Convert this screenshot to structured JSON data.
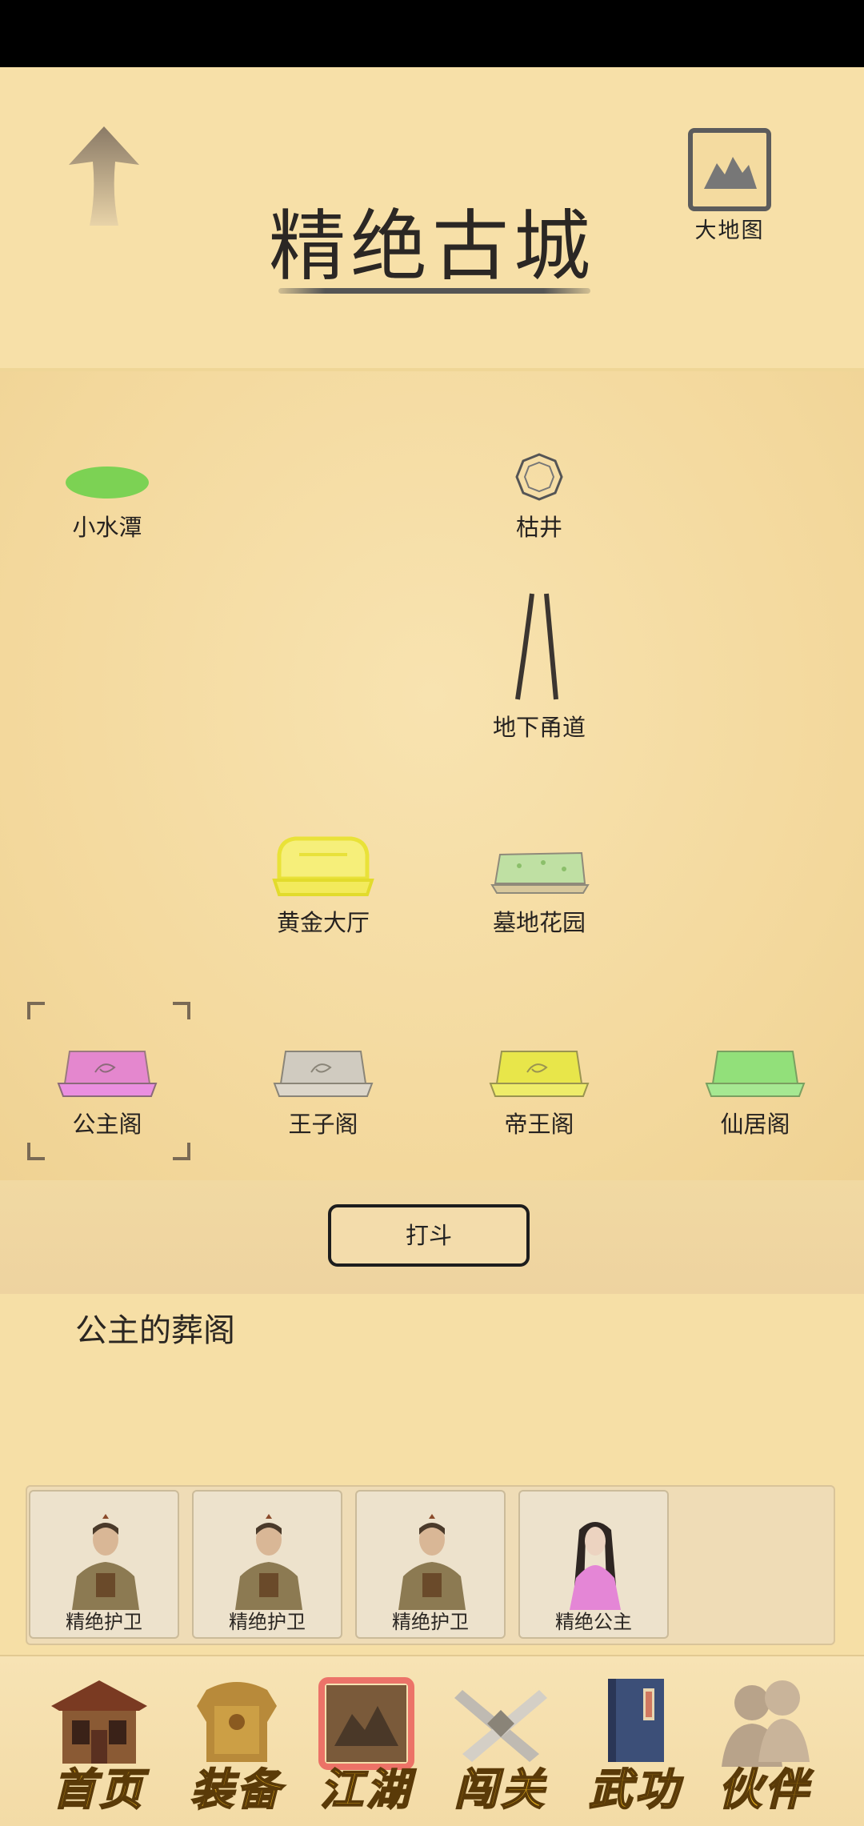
{
  "header": {
    "title": "精绝古城",
    "map_label": "大地图"
  },
  "locations": [
    {
      "label": "小水潭",
      "icon": "pond-icon"
    },
    {
      "label": "枯井",
      "icon": "well-icon"
    },
    {
      "label": "地下甬道",
      "icon": "tunnel-icon"
    },
    {
      "label": "黄金大厅",
      "icon": "golden-hall-icon"
    },
    {
      "label": "墓地花园",
      "icon": "cemetery-garden-icon"
    },
    {
      "label": "公主阁",
      "icon": "pavilion-icon",
      "color": "#e27ad8",
      "selected": true
    },
    {
      "label": "王子阁",
      "icon": "pavilion-icon",
      "color": "#c8c3b8"
    },
    {
      "label": "帝王阁",
      "icon": "pavilion-icon",
      "color": "#e8e64a"
    },
    {
      "label": "仙居阁",
      "icon": "pavilion-icon",
      "color": "#92e07a"
    }
  ],
  "fight_button": "打斗",
  "location_description": "公主的葬阁",
  "party": [
    {
      "name": "精绝护卫",
      "portrait": "guard-portrait-icon"
    },
    {
      "name": "精绝护卫",
      "portrait": "guard-portrait-icon"
    },
    {
      "name": "精绝护卫",
      "portrait": "guard-portrait-icon"
    },
    {
      "name": "精绝公主",
      "portrait": "princess-portrait-icon"
    }
  ],
  "nav": [
    {
      "label": "首页",
      "icon": "house-icon"
    },
    {
      "label": "装备",
      "icon": "armor-icon"
    },
    {
      "label": "江湖",
      "icon": "scroll-map-icon",
      "active": true
    },
    {
      "label": "闯关",
      "icon": "crossed-swords-icon"
    },
    {
      "label": "武功",
      "icon": "martial-book-icon"
    },
    {
      "label": "伙伴",
      "icon": "companions-icon"
    }
  ],
  "colors": {
    "background": "#f6dfa6",
    "nav_label": "#e7b11d",
    "active_glow": "#e8454a"
  }
}
